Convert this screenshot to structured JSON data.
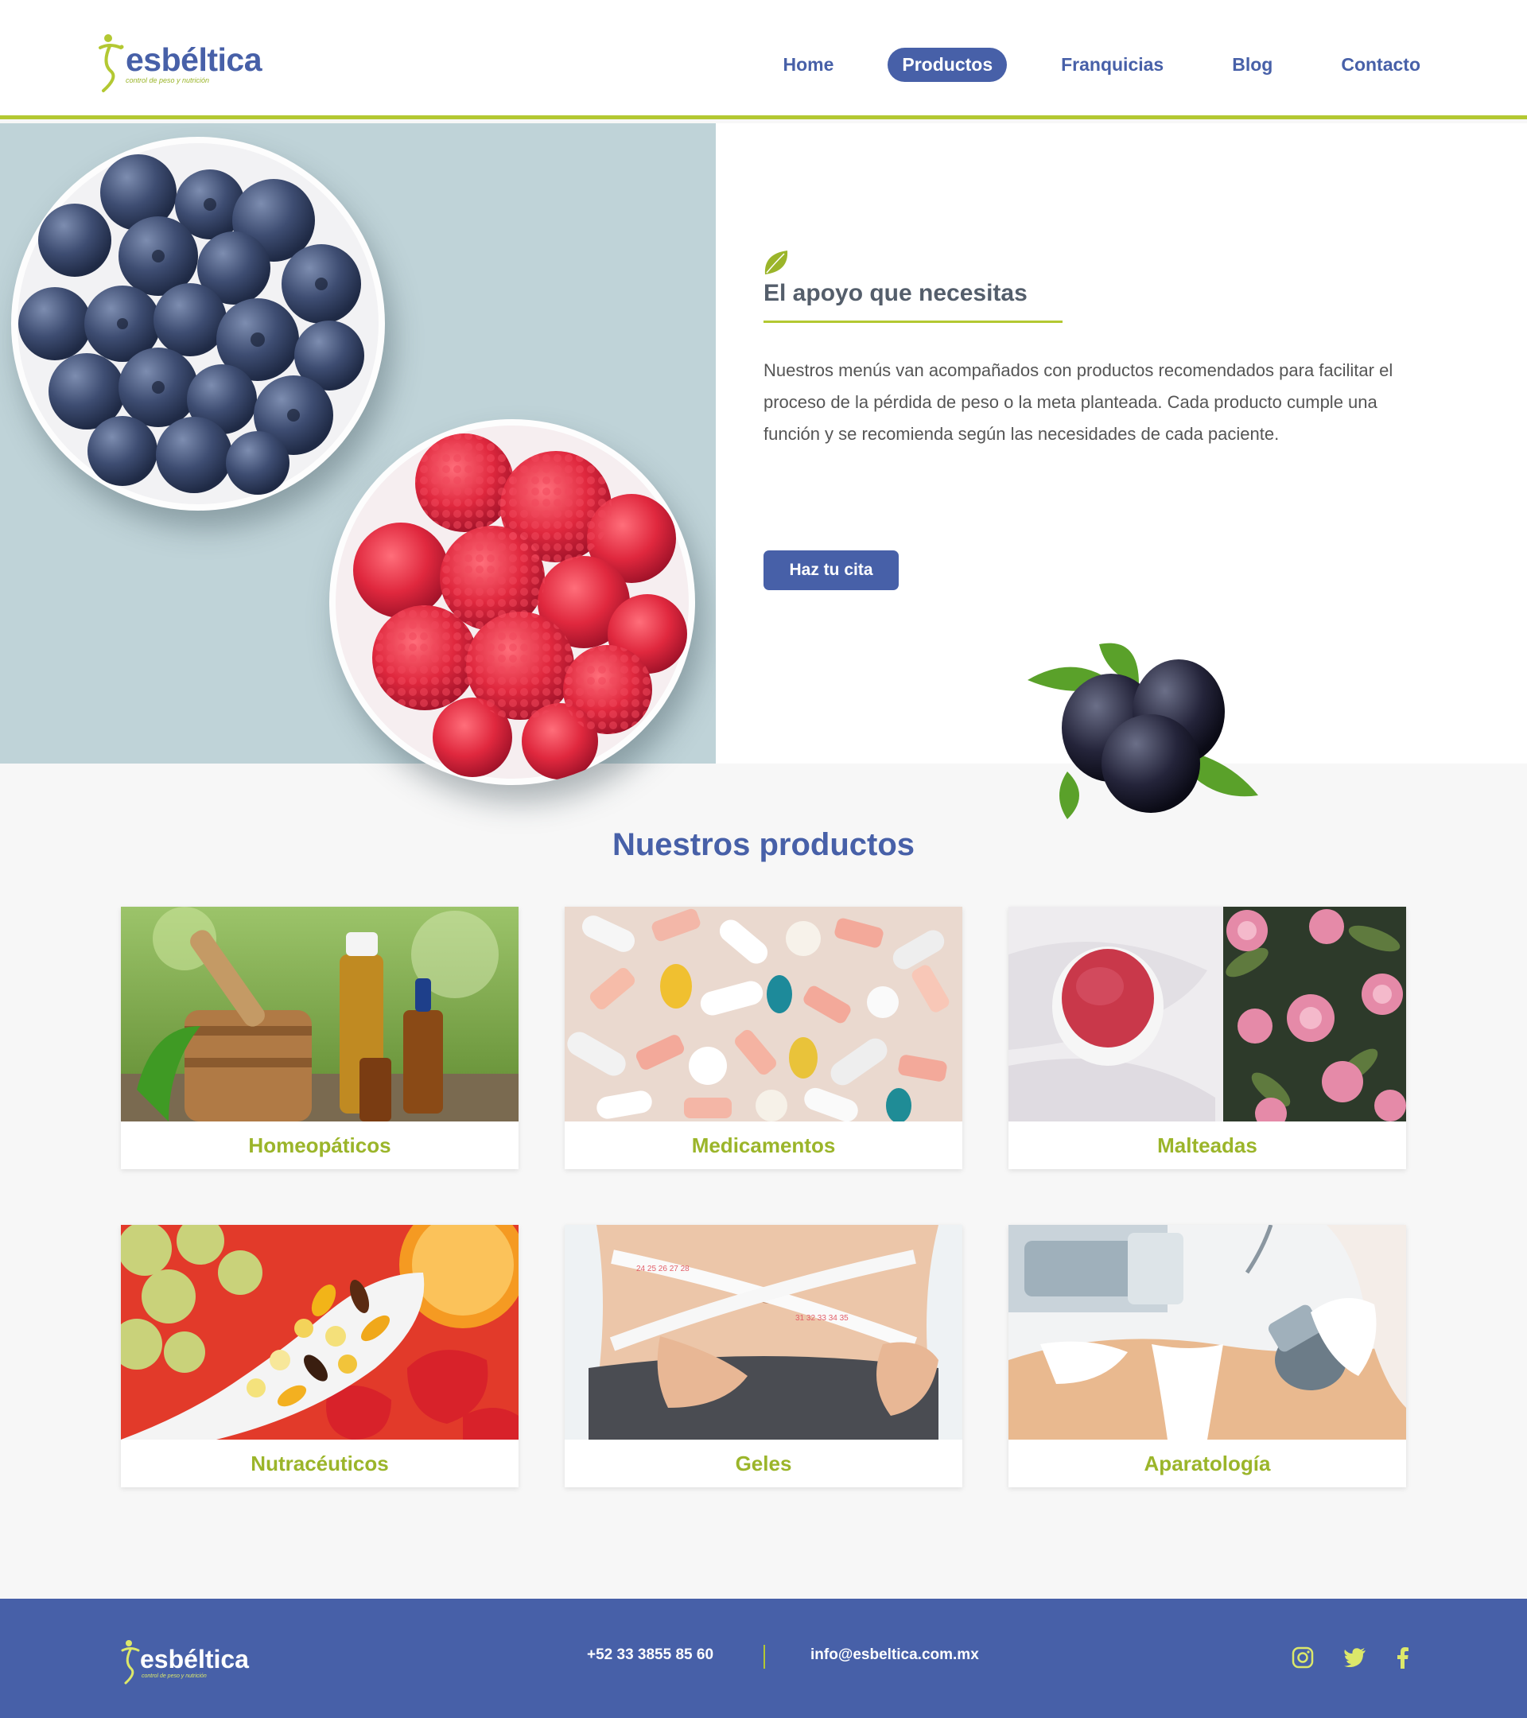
{
  "brand": {
    "name": "esbéltica",
    "tagline": "control de peso y nutrición"
  },
  "nav": {
    "items": [
      {
        "label": "Home",
        "active": false
      },
      {
        "label": "Productos",
        "active": true
      },
      {
        "label": "Franquicias",
        "active": false
      },
      {
        "label": "Blog",
        "active": false
      },
      {
        "label": "Contacto",
        "active": false
      }
    ]
  },
  "hero": {
    "title": "El apoyo que necesitas",
    "text": "Nuestros menús van acompañados con productos recomendados para facilitar el proceso de la pérdida de peso o la meta planteada. Cada producto cumple una función y se recomienda según las necesidades de cada paciente.",
    "cta_label": "Haz tu cita"
  },
  "products": {
    "title": "Nuestros productos",
    "items": [
      {
        "label": "Homeopáticos"
      },
      {
        "label": "Medicamentos"
      },
      {
        "label": "Malteadas"
      },
      {
        "label": "Nutracéuticos"
      },
      {
        "label": "Geles"
      },
      {
        "label": "Aparatología"
      }
    ]
  },
  "footer": {
    "phone": "+52 33 3855 85 60",
    "email": "info@esbeltica.com.mx",
    "social": [
      {
        "icon": "instagram-icon"
      },
      {
        "icon": "twitter-icon"
      },
      {
        "icon": "facebook-icon"
      }
    ]
  },
  "colors": {
    "brand_blue": "#4760a8",
    "accent_green": "#b3c832",
    "label_green": "#9bb52a",
    "hero_bg": "#bfd3d8",
    "page_bg": "#f7f7f7"
  }
}
